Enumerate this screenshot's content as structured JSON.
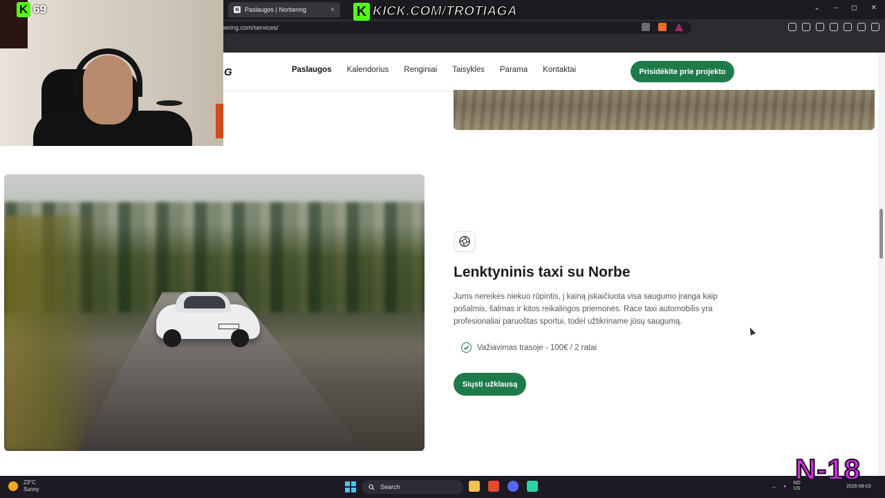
{
  "browser": {
    "tab_title": "Paslaugos | Norbering",
    "tab_favicon": "N",
    "tab_close": "×",
    "url": "bering.com/services/",
    "window_controls": [
      "⌄",
      "–",
      "◻",
      "✕"
    ]
  },
  "site": {
    "logo_tail": "G",
    "nav": [
      "Paslaugos",
      "Kalendorius",
      "Renginiai",
      "Taisyklės",
      "Parama",
      "Kontaktai"
    ],
    "nav_active": "Paslaugos",
    "cta": "Prisidėkite prie projekto",
    "service": {
      "icon": "turbo-icon",
      "title": "Lenktyninis taxi su Norbe",
      "description": "Jums nereikės niekuo rūpintis, į kainą įskaičiuota visa saugumo įranga kaip pošalmis, šalmas ir kitos reikalingos priemonės. Race taxi automobilis yra profesionaliai paruoštas sportui, todėl užtikriname jūsų saugumą.",
      "feature": "Važiavimas trasoje - 100€ / 2 ratai",
      "button": "Siųsti užklausą"
    },
    "accent": "#1f7a4a"
  },
  "overlay": {
    "viewer_count": "69",
    "kick_letter": "K",
    "kick_url": "KICK.COM/TROTIAGA",
    "corner_tag": "N-18"
  },
  "taskbar": {
    "temperature": "23°C",
    "weather": "Sunny",
    "search": "Search",
    "lang_top": "NO",
    "lang_bottom": "US",
    "date": "2026-08-03"
  }
}
